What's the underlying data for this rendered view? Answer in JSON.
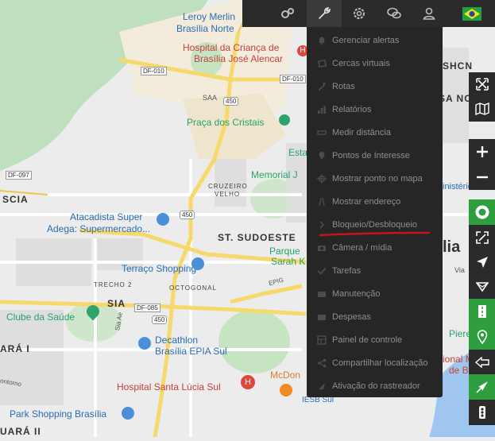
{
  "map": {
    "labels": {
      "leroy": "Leroy Merlin",
      "brasilia_norte": "Brasília Norte",
      "hospital_crianca_1": "Hospital da Criança de",
      "hospital_crianca_2": "Brasília José Alencar",
      "df010_a": "DF-010",
      "df010_b": "DF-010",
      "saa": "SAA",
      "r450_a": "450",
      "praca": "Praça dos Cristais",
      "estado": "Esta",
      "memorial": "Memorial J",
      "df097": "DF-097",
      "scia": "SCIA",
      "cruzeiro_1": "CRUZEIRO",
      "cruzeiro_2": "VELHO",
      "atacadista_1": "Atacadista Super",
      "atacadista_2": "Adega: Supermercado...",
      "r450_b": "450",
      "sudoeste": "ST. SUDOESTE",
      "parque": "Parque",
      "sarah": "Sarah K",
      "terraco": "Terraço Shopping",
      "octogonal": "OCTOGONAL",
      "trecho": "TRECHO 2",
      "epig": "EPIG",
      "sia": "SIA",
      "df085": "DF-085",
      "r450_c": "450",
      "clube": "Clube da Saúde",
      "sia_ae": "Sia Ae",
      "ara": "ARÁ I",
      "decathlon_1": "Decathlon",
      "decathlon_2": "Brasília EPIA Sul",
      "hospital_lucia": "Hospital Santa Lúcia Sul",
      "mcdo": "McDon",
      "contorno": "ontorno",
      "park": "Park Shopping Brasília",
      "ara2": "UARÁ II",
      "iesb": "IESB Sul",
      "shcn": "SHCN",
      "sanorte": "SA NORTE",
      "ministerios": "inistérios",
      "lia": "lia",
      "via": "Via",
      "piere": "Piere",
      "mane": "ional Ma",
      "brasil": "de Br"
    }
  },
  "topbar": {
    "settings_group_icon": "gears-icon",
    "tools_icon": "wrench-icon",
    "gear_icon": "gear-icon",
    "chat_icon": "chat-icon",
    "user_icon": "user-icon",
    "language_flag": "brazil-flag-icon"
  },
  "menu": {
    "items": [
      {
        "label": "Gerenciar alertas",
        "icon": "bell-icon"
      },
      {
        "label": "Cercas virtuais",
        "icon": "geofence-icon"
      },
      {
        "label": "Rotas",
        "icon": "route-icon"
      },
      {
        "label": "Relatórios",
        "icon": "bar-chart-icon"
      },
      {
        "label": "Medir distância",
        "icon": "ruler-icon"
      },
      {
        "label": "Pontos de Interesse",
        "icon": "map-pin-icon"
      },
      {
        "label": "Mostrar ponto no mapa",
        "icon": "crosshair-icon"
      },
      {
        "label": "Mostrar endereço",
        "icon": "road-icon"
      },
      {
        "label": "Bloqueio/Desbloqueio",
        "icon": "chevron-right-icon"
      },
      {
        "label": "Câmera / mídia",
        "icon": "camera-icon"
      },
      {
        "label": "Tarefas",
        "icon": "tasks-icon"
      },
      {
        "label": "Manutenção",
        "icon": "maintenance-icon"
      },
      {
        "label": "Despesas",
        "icon": "wallet-icon"
      },
      {
        "label": "Painel de controle",
        "icon": "dashboard-icon"
      },
      {
        "label": "Compartilhar localização",
        "icon": "share-icon"
      },
      {
        "label": "Ativação do rastreador",
        "icon": "activation-icon"
      }
    ]
  },
  "rightbar": {
    "buttons": [
      {
        "icon": "fullscreen-icon",
        "color": "#2b2b2b"
      },
      {
        "icon": "map-layers-icon",
        "color": "#2b2b2b"
      },
      {
        "icon": "zoom-in-icon",
        "color": "#2b2b2b"
      },
      {
        "icon": "zoom-out-icon",
        "color": "#2b2b2b"
      },
      {
        "icon": "target-toggle-icon",
        "color": "#2e9e3e"
      },
      {
        "icon": "fit-bounds-icon",
        "color": "#2b2b2b"
      },
      {
        "icon": "navigation-arrow-icon",
        "color": "#2b2b2b"
      },
      {
        "icon": "dropdown-triangle-icon",
        "color": "#2b2b2b"
      },
      {
        "icon": "road-view-icon",
        "color": "#2e9e3e"
      },
      {
        "icon": "location-pin-icon",
        "color": "#2e9e3e"
      },
      {
        "icon": "history-back-icon",
        "color": "#2b2b2b"
      },
      {
        "icon": "send-location-icon",
        "color": "#2e9e3e"
      },
      {
        "icon": "traffic-light-icon",
        "color": "#2b2b2b"
      }
    ]
  },
  "colors": {
    "annotation_underline": "#c8141c",
    "menu_bg": "#262626",
    "accent_green": "#2e9e3e"
  }
}
